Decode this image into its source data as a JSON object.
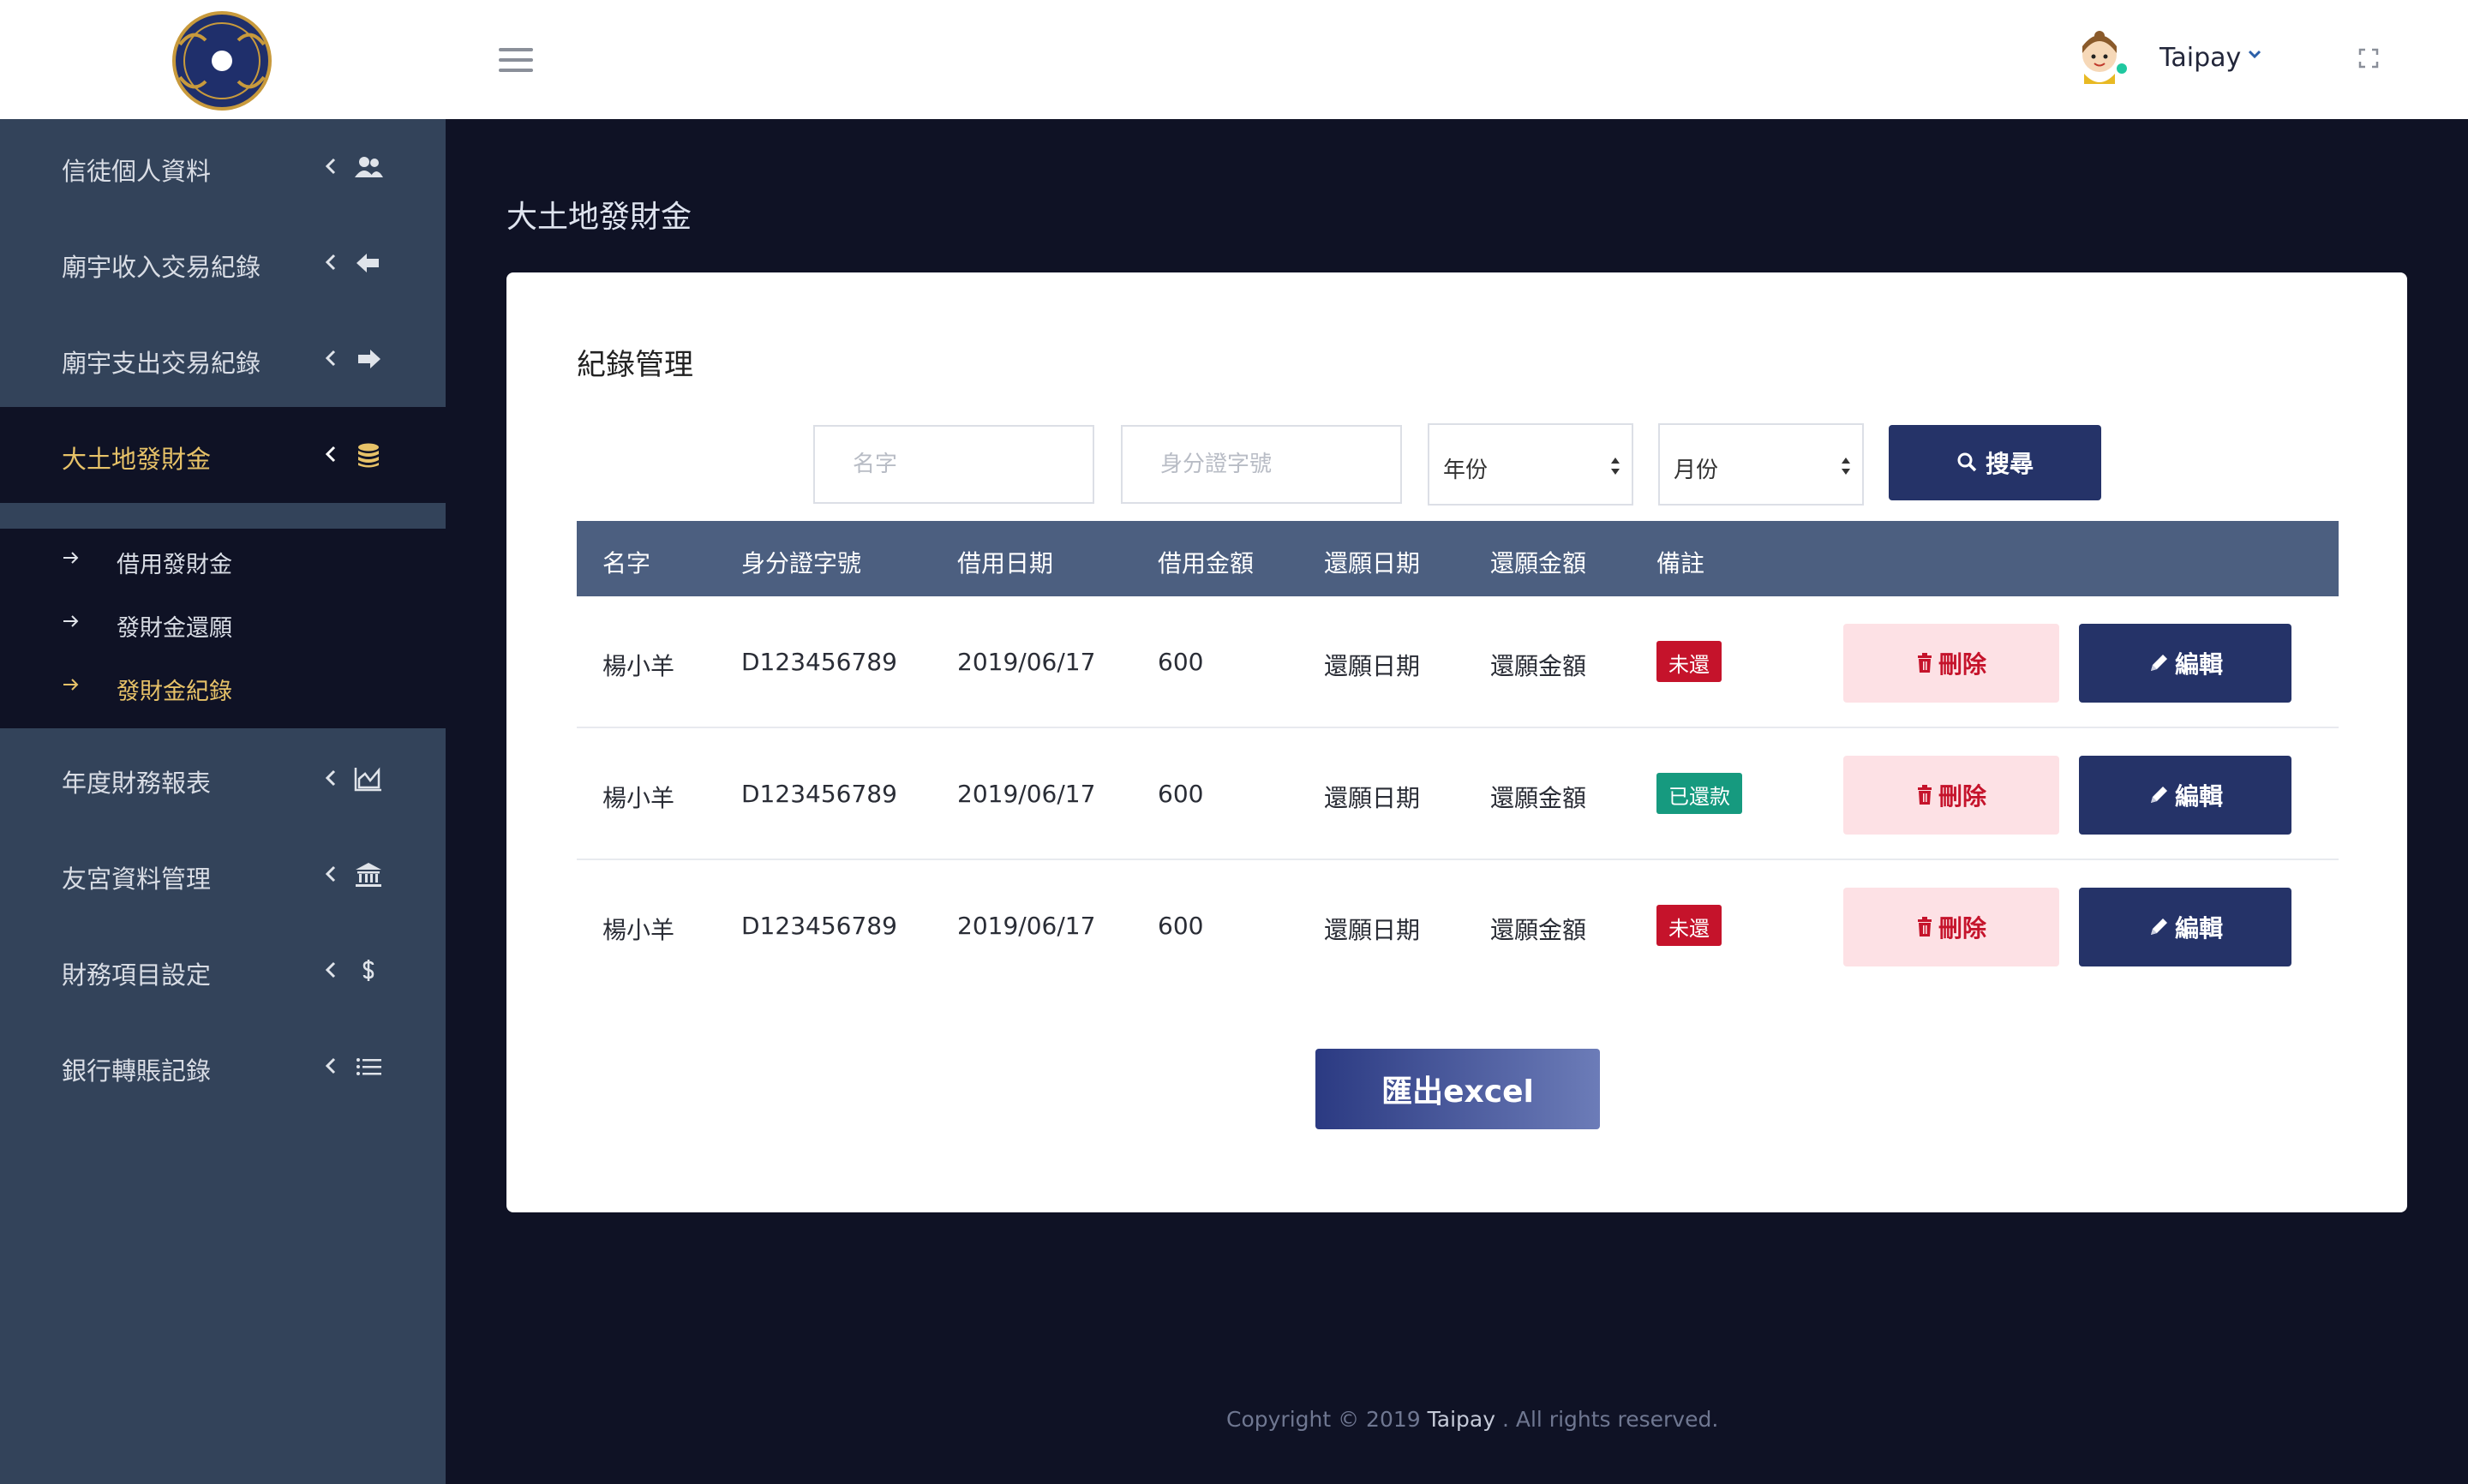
{
  "header": {
    "user_name": "Taipay"
  },
  "sidebar": {
    "items": [
      {
        "label": "信徒個人資料",
        "icon": "users-icon"
      },
      {
        "label": "廟宇收入交易紀錄",
        "icon": "arrow-left-icon"
      },
      {
        "label": "廟宇支出交易紀錄",
        "icon": "arrow-right-icon"
      },
      {
        "label": "大土地發財金",
        "icon": "coins-icon",
        "active": true
      },
      {
        "label": "年度財務報表",
        "icon": "chart-area-icon"
      },
      {
        "label": "友宮資料管理",
        "icon": "bank-icon"
      },
      {
        "label": "財務項目設定",
        "icon": "dollar-icon"
      },
      {
        "label": "銀行轉賬記錄",
        "icon": "list-icon"
      }
    ],
    "submenu": [
      {
        "label": "借用發財金"
      },
      {
        "label": "發財金還願"
      },
      {
        "label": "發財金紀錄",
        "active": true
      }
    ]
  },
  "page": {
    "title": "大土地發財金"
  },
  "card": {
    "title": "紀錄管理",
    "filters": {
      "name_placeholder": "名字",
      "id_placeholder": "身分證字號",
      "year_value": "年份",
      "month_value": "月份",
      "search_label": "搜尋"
    },
    "table": {
      "headers": [
        "名字",
        "身分證字號",
        "借用日期",
        "借用金額",
        "還願日期",
        "還願金額",
        "備註"
      ],
      "rows": [
        {
          "name": "楊小羊",
          "id": "D123456789",
          "borrow_date": "2019/06/17",
          "amount": "600",
          "return_date": "還願日期",
          "return_amount": "還願金額",
          "status": "未還",
          "status_color": "#c5132b"
        },
        {
          "name": "楊小羊",
          "id": "D123456789",
          "borrow_date": "2019/06/17",
          "amount": "600",
          "return_date": "還願日期",
          "return_amount": "還願金額",
          "status": "已還款",
          "status_color": "#169a7f"
        },
        {
          "name": "楊小羊",
          "id": "D123456789",
          "borrow_date": "2019/06/17",
          "amount": "600",
          "return_date": "還願日期",
          "return_amount": "還願金額",
          "status": "未還",
          "status_color": "#c5132b"
        }
      ],
      "delete_label": "刪除",
      "edit_label": "編輯"
    },
    "export_label": "匯出excel"
  },
  "footer": {
    "prefix": "Copyright © 2019 ",
    "brand": "Taipay",
    "suffix": " . All rights reserved."
  },
  "colors": {
    "primary": "#253368",
    "sidebar_bg": "#33435a",
    "dark_bg": "#0f1225",
    "accent_gold": "#e7c268",
    "table_header": "#4c5f80",
    "danger": "#c5132b",
    "danger_bg": "#fde1e5",
    "success": "#169a7f"
  }
}
